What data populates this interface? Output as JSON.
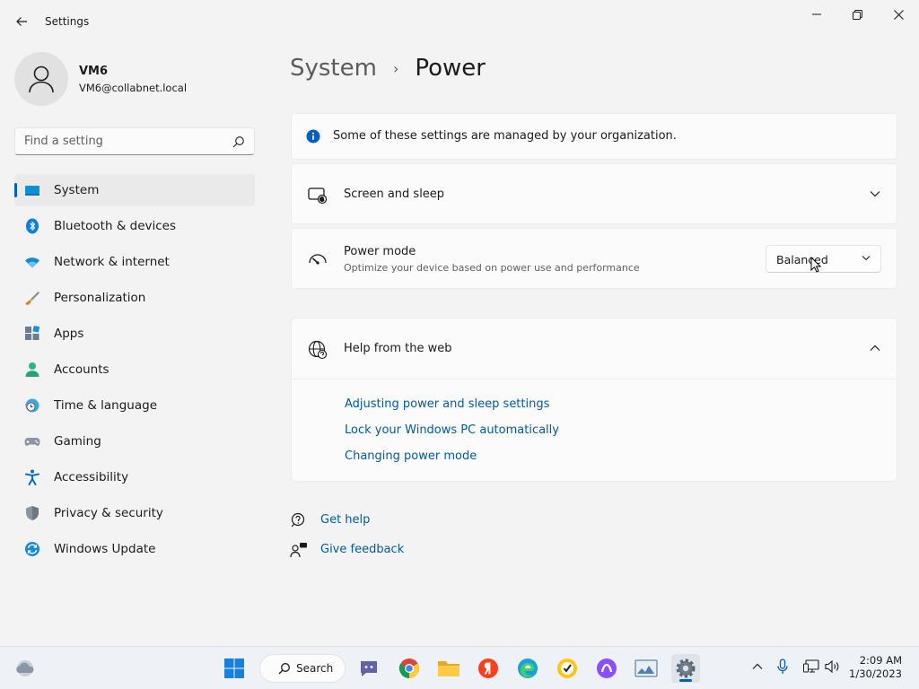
{
  "window": {
    "title": "Settings",
    "minimize_icon": "minimize-icon",
    "maximize_icon": "restore-icon",
    "close_icon": "close-icon"
  },
  "profile": {
    "name": "VM6",
    "email": "VM6@collabnet.local"
  },
  "search": {
    "placeholder": "Find a setting"
  },
  "sidebar": {
    "items": [
      {
        "label": "System",
        "icon": "monitor-icon",
        "selected": true
      },
      {
        "label": "Bluetooth & devices",
        "icon": "bluetooth-icon"
      },
      {
        "label": "Network & internet",
        "icon": "wifi-icon"
      },
      {
        "label": "Personalization",
        "icon": "brush-icon"
      },
      {
        "label": "Apps",
        "icon": "apps-icon"
      },
      {
        "label": "Accounts",
        "icon": "person-icon"
      },
      {
        "label": "Time & language",
        "icon": "clock-globe-icon"
      },
      {
        "label": "Gaming",
        "icon": "gamepad-icon"
      },
      {
        "label": "Accessibility",
        "icon": "accessibility-icon"
      },
      {
        "label": "Privacy & security",
        "icon": "shield-icon"
      },
      {
        "label": "Windows Update",
        "icon": "update-icon"
      }
    ]
  },
  "breadcrumb": {
    "parent": "System",
    "separator": "›",
    "current": "Power"
  },
  "info": {
    "text": "Some of these settings are managed by your organization."
  },
  "screen_sleep": {
    "title": "Screen and sleep"
  },
  "power_mode": {
    "title": "Power mode",
    "subtitle": "Optimize your device based on power use and performance",
    "selected": "Balanced"
  },
  "help": {
    "title": "Help from the web",
    "links": [
      "Adjusting power and sleep settings",
      "Lock your Windows PC automatically",
      "Changing power mode"
    ]
  },
  "footer_links": {
    "get_help": "Get help",
    "give_feedback": "Give feedback"
  },
  "taskbar": {
    "search_label": "Search",
    "time": "2:09 AM",
    "date": "1/30/2023"
  },
  "colors": {
    "accent": "#005fb8",
    "link": "#005a9e",
    "background": "#f3f3f3",
    "card": "#fbfbfb"
  }
}
